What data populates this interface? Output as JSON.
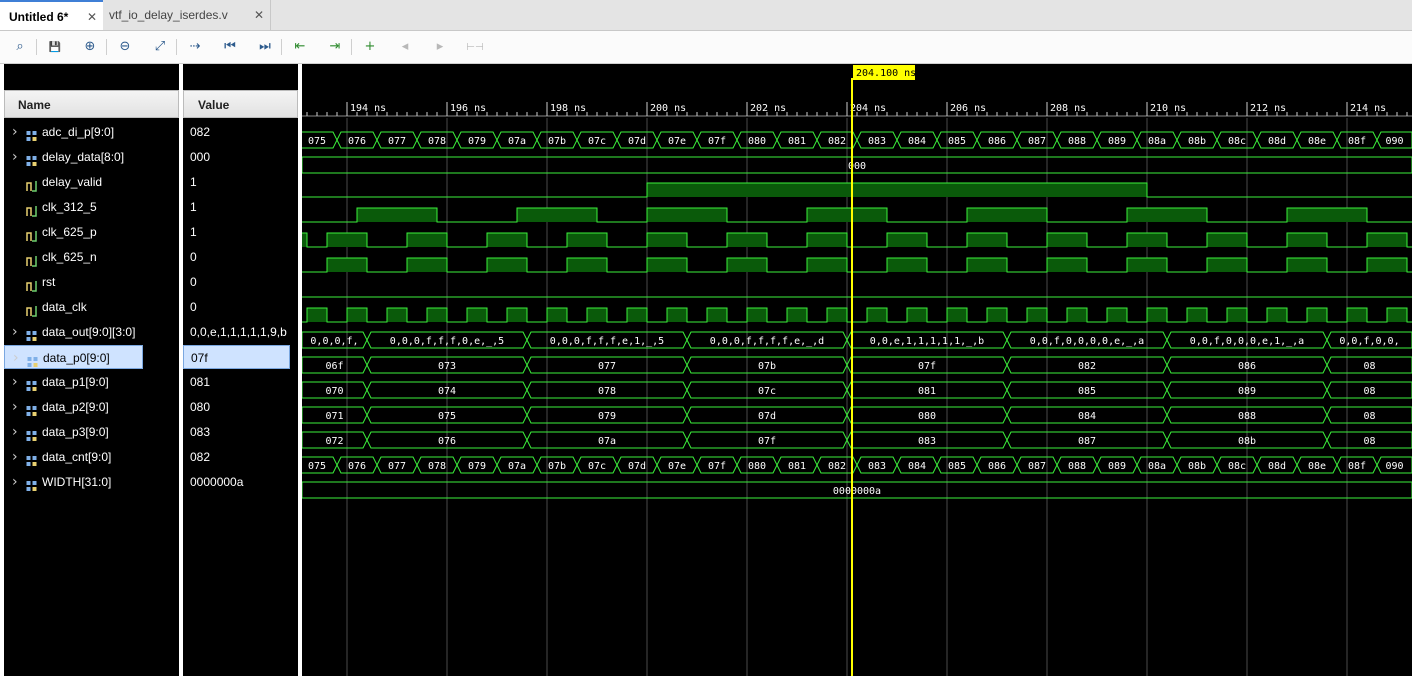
{
  "tabs": [
    {
      "label": "Untitled 6*",
      "active": true
    },
    {
      "label": "vtf_io_delay_iserdes.v",
      "active": false
    }
  ],
  "toolbar": [
    {
      "name": "search-icon",
      "glyph": "⌕"
    },
    {
      "name": "save-icon",
      "glyph": "💾"
    },
    {
      "name": "zoom-in-icon",
      "glyph": "⊕"
    },
    {
      "name": "zoom-out-icon",
      "glyph": "⊖"
    },
    {
      "name": "zoom-fit-icon",
      "glyph": "⤢"
    },
    {
      "name": "go-to-cursor-icon",
      "glyph": "⇢"
    },
    {
      "name": "go-to-time-zero-icon",
      "glyph": "⏮"
    },
    {
      "name": "go-to-last-time-icon",
      "glyph": "⏭"
    },
    {
      "name": "previous-transition-icon",
      "glyph": "⇤"
    },
    {
      "name": "next-transition-icon",
      "glyph": "⇥"
    },
    {
      "name": "add-marker-icon",
      "glyph": "+"
    },
    {
      "name": "previous-marker-icon",
      "glyph": "◂"
    },
    {
      "name": "next-marker-icon",
      "glyph": "▸"
    },
    {
      "name": "swap-cursors-icon",
      "glyph": "⊢⊣"
    }
  ],
  "headers": {
    "name": "Name",
    "value": "Value"
  },
  "cursor": {
    "label": "204.100 ns",
    "time": 204.1
  },
  "timeline": {
    "start": 193.1,
    "end": 215.3,
    "labels": [
      194,
      196,
      198,
      200,
      202,
      204,
      206,
      208,
      210,
      212,
      214
    ],
    "unit": "ns"
  },
  "signals": [
    {
      "name": "adc_di_p[9:0]",
      "value": "082",
      "type": "bus",
      "expandable": true
    },
    {
      "name": "delay_data[8:0]",
      "value": "000",
      "type": "bus",
      "expandable": true
    },
    {
      "name": "delay_valid",
      "value": "1",
      "type": "bit",
      "expandable": false
    },
    {
      "name": "clk_312_5",
      "value": "1",
      "type": "bit",
      "expandable": false
    },
    {
      "name": "clk_625_p",
      "value": "1",
      "type": "bit",
      "expandable": false
    },
    {
      "name": "clk_625_n",
      "value": "0",
      "type": "bit",
      "expandable": false
    },
    {
      "name": "rst",
      "value": "0",
      "type": "bit",
      "expandable": false
    },
    {
      "name": "data_clk",
      "value": "0",
      "type": "bit",
      "expandable": false
    },
    {
      "name": "data_out[9:0][3:0]",
      "value": "0,0,e,1,1,1,1,1,9,b",
      "type": "bus",
      "expandable": true
    },
    {
      "name": "data_p0[9:0]",
      "value": "07f",
      "type": "bus",
      "expandable": true,
      "selected": true
    },
    {
      "name": "data_p1[9:0]",
      "value": "081",
      "type": "bus",
      "expandable": true
    },
    {
      "name": "data_p2[9:0]",
      "value": "080",
      "type": "bus",
      "expandable": true
    },
    {
      "name": "data_p3[9:0]",
      "value": "083",
      "type": "bus",
      "expandable": true
    },
    {
      "name": "data_cnt[9:0]",
      "value": "082",
      "type": "bus",
      "expandable": true
    },
    {
      "name": "WIDTH[31:0]",
      "value": "0000000a",
      "type": "bus",
      "expandable": true
    }
  ],
  "waves": {
    "adc_di_p": {
      "start": 193.1,
      "labels": [
        "075",
        "076",
        "077",
        "078",
        "079",
        "07a",
        "07b",
        "07c",
        "07d",
        "07e",
        "07f",
        "080",
        "081",
        "082",
        "083",
        "084",
        "085",
        "086",
        "087",
        "088",
        "089",
        "08a",
        "08b",
        "08c",
        "08d",
        "08e",
        "08f",
        "090"
      ]
    },
    "delay_data": {
      "start": 193.1,
      "end": 215.3,
      "label": "000"
    },
    "delay_valid": {
      "level0": 0,
      "rise": 200.0,
      "fall": 210.0
    },
    "clk_312_5": {
      "edges": [
        194.2,
        195.8,
        197.4,
        199.0,
        200.0,
        201.6,
        203.2,
        204.8,
        206.4,
        208.0,
        209.6,
        211.2,
        212.8,
        214.4
      ],
      "initial": 0
    },
    "clk_625_p": {
      "edges": [
        193.2,
        193.6,
        194.4,
        195.2,
        196.0,
        196.8,
        197.6,
        198.4,
        199.2,
        200.0,
        200.8,
        201.6,
        202.4,
        203.2,
        204.0,
        204.8,
        205.6,
        206.4,
        207.2,
        208.0,
        208.8,
        209.6,
        210.4,
        211.2,
        212.0,
        212.8,
        213.6,
        214.4,
        215.2
      ],
      "initial": 1
    },
    "clk_625_n": {
      "edges": [
        193.6,
        194.4,
        195.2,
        196.0,
        196.8,
        197.6,
        198.4,
        199.2,
        200.0,
        200.8,
        201.6,
        202.4,
        203.2,
        204.0,
        204.8,
        205.6,
        206.4,
        207.2,
        208.0,
        208.8,
        209.6,
        210.4,
        211.2,
        212.0,
        212.8,
        213.6,
        214.4,
        215.2
      ],
      "initial": 0
    },
    "rst": {
      "level0": 0
    },
    "data_clk": {
      "edges": [
        193.2,
        193.6,
        194.0,
        194.4,
        194.8,
        195.2,
        195.6,
        196.0,
        196.4,
        196.8,
        197.2,
        197.6,
        198.0,
        198.4,
        198.8,
        199.2,
        199.6,
        200.0,
        200.4,
        200.8,
        201.2,
        201.6,
        202.0,
        202.4,
        202.8,
        203.2,
        203.6,
        204.0,
        204.4,
        204.8,
        205.2,
        205.6,
        206.0,
        206.4,
        206.8,
        207.2,
        207.6,
        208.0,
        208.4,
        208.8,
        209.2,
        209.6,
        210.0,
        210.4,
        210.8,
        211.2,
        211.6,
        212.0,
        212.4,
        212.8,
        213.2,
        213.6,
        214.0,
        214.4,
        214.8,
        215.2
      ],
      "initial": 0
    },
    "data_out": {
      "segments": [
        {
          "t0": 193.1,
          "t1": 194.4,
          "label": "0,0,0,f,"
        },
        {
          "t0": 194.4,
          "t1": 197.6,
          "label": "0,0,0,f,f,f,0,e,_,5"
        },
        {
          "t0": 197.6,
          "t1": 200.8,
          "label": "0,0,0,f,f,f,e,1,_,5"
        },
        {
          "t0": 200.8,
          "t1": 204.0,
          "label": "0,0,0,f,f,f,f,e,_,d"
        },
        {
          "t0": 204.0,
          "t1": 207.2,
          "label": "0,0,e,1,1,1,1,1,_,b"
        },
        {
          "t0": 207.2,
          "t1": 210.4,
          "label": "0,0,f,0,0,0,0,e,_,a"
        },
        {
          "t0": 210.4,
          "t1": 213.6,
          "label": "0,0,f,0,0,0,e,1,_,a"
        },
        {
          "t0": 213.6,
          "t1": 215.3,
          "label": "0,0,f,0,0,"
        }
      ]
    },
    "data_p0": {
      "segments": [
        {
          "t0": 193.1,
          "t1": 194.4,
          "label": "06f"
        },
        {
          "t0": 194.4,
          "t1": 197.6,
          "label": "073"
        },
        {
          "t0": 197.6,
          "t1": 200.8,
          "label": "077"
        },
        {
          "t0": 200.8,
          "t1": 204.0,
          "label": "07b"
        },
        {
          "t0": 204.0,
          "t1": 207.2,
          "label": "07f"
        },
        {
          "t0": 207.2,
          "t1": 210.4,
          "label": "082"
        },
        {
          "t0": 210.4,
          "t1": 213.6,
          "label": "086"
        },
        {
          "t0": 213.6,
          "t1": 215.3,
          "label": "08"
        }
      ]
    },
    "data_p1": {
      "segments": [
        {
          "t0": 193.1,
          "t1": 194.4,
          "label": "070"
        },
        {
          "t0": 194.4,
          "t1": 197.6,
          "label": "074"
        },
        {
          "t0": 197.6,
          "t1": 200.8,
          "label": "078"
        },
        {
          "t0": 200.8,
          "t1": 204.0,
          "label": "07c"
        },
        {
          "t0": 204.0,
          "t1": 207.2,
          "label": "081"
        },
        {
          "t0": 207.2,
          "t1": 210.4,
          "label": "085"
        },
        {
          "t0": 210.4,
          "t1": 213.6,
          "label": "089"
        },
        {
          "t0": 213.6,
          "t1": 215.3,
          "label": "08"
        }
      ]
    },
    "data_p2": {
      "segments": [
        {
          "t0": 193.1,
          "t1": 194.4,
          "label": "071"
        },
        {
          "t0": 194.4,
          "t1": 197.6,
          "label": "075"
        },
        {
          "t0": 197.6,
          "t1": 200.8,
          "label": "079"
        },
        {
          "t0": 200.8,
          "t1": 204.0,
          "label": "07d"
        },
        {
          "t0": 204.0,
          "t1": 207.2,
          "label": "080"
        },
        {
          "t0": 207.2,
          "t1": 210.4,
          "label": "084"
        },
        {
          "t0": 210.4,
          "t1": 213.6,
          "label": "088"
        },
        {
          "t0": 213.6,
          "t1": 215.3,
          "label": "08"
        }
      ]
    },
    "data_p3": {
      "segments": [
        {
          "t0": 193.1,
          "t1": 194.4,
          "label": "072"
        },
        {
          "t0": 194.4,
          "t1": 197.6,
          "label": "076"
        },
        {
          "t0": 197.6,
          "t1": 200.8,
          "label": "07a"
        },
        {
          "t0": 200.8,
          "t1": 204.0,
          "label": "07f"
        },
        {
          "t0": 204.0,
          "t1": 207.2,
          "label": "083"
        },
        {
          "t0": 207.2,
          "t1": 210.4,
          "label": "087"
        },
        {
          "t0": 210.4,
          "t1": 213.6,
          "label": "08b"
        },
        {
          "t0": 213.6,
          "t1": 215.3,
          "label": "08"
        }
      ]
    },
    "data_cnt": {
      "start": 193.1,
      "labels": [
        "075",
        "076",
        "077",
        "078",
        "079",
        "07a",
        "07b",
        "07c",
        "07d",
        "07e",
        "07f",
        "080",
        "081",
        "082",
        "083",
        "084",
        "085",
        "086",
        "087",
        "088",
        "089",
        "08a",
        "08b",
        "08c",
        "08d",
        "08e",
        "08f",
        "090"
      ]
    },
    "WIDTH": {
      "start": 193.1,
      "end": 215.3,
      "label": "0000000a"
    }
  },
  "colors": {
    "wave": "#3cf03c",
    "fill": "#0a5a0a",
    "cursor": "#ffff00",
    "grid": "#4a4a4a",
    "ruler": "#ffffff",
    "background": "#000000"
  }
}
